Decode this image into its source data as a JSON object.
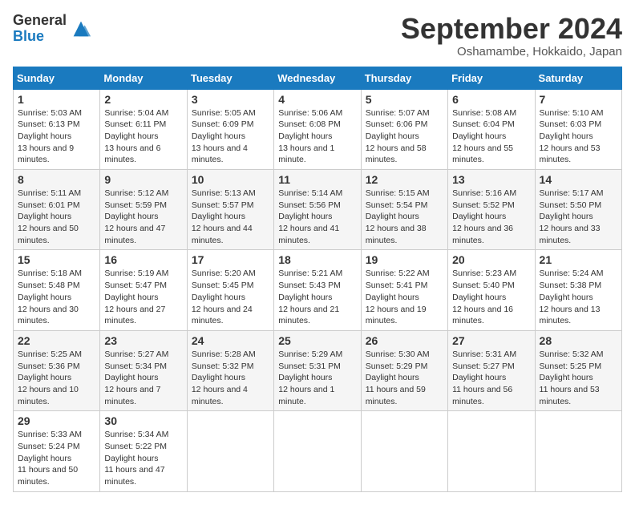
{
  "header": {
    "logo_general": "General",
    "logo_blue": "Blue",
    "month_title": "September 2024",
    "location": "Oshamambe, Hokkaido, Japan"
  },
  "calendar": {
    "days_of_week": [
      "Sunday",
      "Monday",
      "Tuesday",
      "Wednesday",
      "Thursday",
      "Friday",
      "Saturday"
    ],
    "weeks": [
      [
        {
          "day": "1",
          "sunrise": "5:03 AM",
          "sunset": "6:13 PM",
          "daylight": "13 hours and 9 minutes."
        },
        {
          "day": "2",
          "sunrise": "5:04 AM",
          "sunset": "6:11 PM",
          "daylight": "13 hours and 6 minutes."
        },
        {
          "day": "3",
          "sunrise": "5:05 AM",
          "sunset": "6:09 PM",
          "daylight": "13 hours and 4 minutes."
        },
        {
          "day": "4",
          "sunrise": "5:06 AM",
          "sunset": "6:08 PM",
          "daylight": "13 hours and 1 minute."
        },
        {
          "day": "5",
          "sunrise": "5:07 AM",
          "sunset": "6:06 PM",
          "daylight": "12 hours and 58 minutes."
        },
        {
          "day": "6",
          "sunrise": "5:08 AM",
          "sunset": "6:04 PM",
          "daylight": "12 hours and 55 minutes."
        },
        {
          "day": "7",
          "sunrise": "5:10 AM",
          "sunset": "6:03 PM",
          "daylight": "12 hours and 53 minutes."
        }
      ],
      [
        {
          "day": "8",
          "sunrise": "5:11 AM",
          "sunset": "6:01 PM",
          "daylight": "12 hours and 50 minutes."
        },
        {
          "day": "9",
          "sunrise": "5:12 AM",
          "sunset": "5:59 PM",
          "daylight": "12 hours and 47 minutes."
        },
        {
          "day": "10",
          "sunrise": "5:13 AM",
          "sunset": "5:57 PM",
          "daylight": "12 hours and 44 minutes."
        },
        {
          "day": "11",
          "sunrise": "5:14 AM",
          "sunset": "5:56 PM",
          "daylight": "12 hours and 41 minutes."
        },
        {
          "day": "12",
          "sunrise": "5:15 AM",
          "sunset": "5:54 PM",
          "daylight": "12 hours and 38 minutes."
        },
        {
          "day": "13",
          "sunrise": "5:16 AM",
          "sunset": "5:52 PM",
          "daylight": "12 hours and 36 minutes."
        },
        {
          "day": "14",
          "sunrise": "5:17 AM",
          "sunset": "5:50 PM",
          "daylight": "12 hours and 33 minutes."
        }
      ],
      [
        {
          "day": "15",
          "sunrise": "5:18 AM",
          "sunset": "5:48 PM",
          "daylight": "12 hours and 30 minutes."
        },
        {
          "day": "16",
          "sunrise": "5:19 AM",
          "sunset": "5:47 PM",
          "daylight": "12 hours and 27 minutes."
        },
        {
          "day": "17",
          "sunrise": "5:20 AM",
          "sunset": "5:45 PM",
          "daylight": "12 hours and 24 minutes."
        },
        {
          "day": "18",
          "sunrise": "5:21 AM",
          "sunset": "5:43 PM",
          "daylight": "12 hours and 21 minutes."
        },
        {
          "day": "19",
          "sunrise": "5:22 AM",
          "sunset": "5:41 PM",
          "daylight": "12 hours and 19 minutes."
        },
        {
          "day": "20",
          "sunrise": "5:23 AM",
          "sunset": "5:40 PM",
          "daylight": "12 hours and 16 minutes."
        },
        {
          "day": "21",
          "sunrise": "5:24 AM",
          "sunset": "5:38 PM",
          "daylight": "12 hours and 13 minutes."
        }
      ],
      [
        {
          "day": "22",
          "sunrise": "5:25 AM",
          "sunset": "5:36 PM",
          "daylight": "12 hours and 10 minutes."
        },
        {
          "day": "23",
          "sunrise": "5:27 AM",
          "sunset": "5:34 PM",
          "daylight": "12 hours and 7 minutes."
        },
        {
          "day": "24",
          "sunrise": "5:28 AM",
          "sunset": "5:32 PM",
          "daylight": "12 hours and 4 minutes."
        },
        {
          "day": "25",
          "sunrise": "5:29 AM",
          "sunset": "5:31 PM",
          "daylight": "12 hours and 1 minute."
        },
        {
          "day": "26",
          "sunrise": "5:30 AM",
          "sunset": "5:29 PM",
          "daylight": "11 hours and 59 minutes."
        },
        {
          "day": "27",
          "sunrise": "5:31 AM",
          "sunset": "5:27 PM",
          "daylight": "11 hours and 56 minutes."
        },
        {
          "day": "28",
          "sunrise": "5:32 AM",
          "sunset": "5:25 PM",
          "daylight": "11 hours and 53 minutes."
        }
      ],
      [
        {
          "day": "29",
          "sunrise": "5:33 AM",
          "sunset": "5:24 PM",
          "daylight": "11 hours and 50 minutes."
        },
        {
          "day": "30",
          "sunrise": "5:34 AM",
          "sunset": "5:22 PM",
          "daylight": "11 hours and 47 minutes."
        },
        {
          "day": "",
          "sunrise": "",
          "sunset": "",
          "daylight": ""
        },
        {
          "day": "",
          "sunrise": "",
          "sunset": "",
          "daylight": ""
        },
        {
          "day": "",
          "sunrise": "",
          "sunset": "",
          "daylight": ""
        },
        {
          "day": "",
          "sunrise": "",
          "sunset": "",
          "daylight": ""
        },
        {
          "day": "",
          "sunrise": "",
          "sunset": "",
          "daylight": ""
        }
      ]
    ],
    "sunrise_label": "Sunrise:",
    "sunset_label": "Sunset:",
    "daylight_label": "Daylight hours"
  }
}
